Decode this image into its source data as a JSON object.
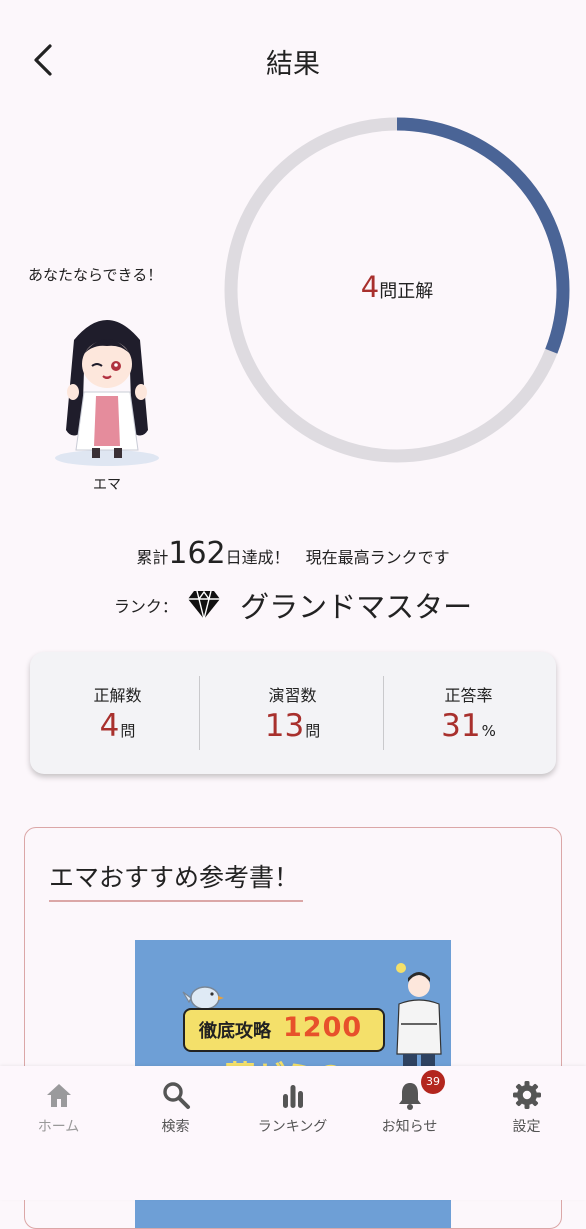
{
  "header": {
    "title": "結果",
    "back_icon": "chevron-left-icon"
  },
  "character": {
    "speech": "あなたならできる！",
    "name": "エマ"
  },
  "progress": {
    "correct_count": "4",
    "correct_unit": "問正解",
    "fraction": 0.31,
    "fill_color": "#4a6496",
    "track_color": "#dedbe0"
  },
  "streak": {
    "prefix": "累計",
    "days": "162",
    "suffix": "日達成！　現在最高ランクです"
  },
  "rank": {
    "prefix": "ランク：",
    "name": "グランドマスター",
    "icon": "diamond-icon"
  },
  "stats": [
    {
      "label": "正解数",
      "value": "4",
      "unit": "問"
    },
    {
      "label": "演習数",
      "value": "13",
      "unit": "問"
    },
    {
      "label": "正答率",
      "value": "31",
      "unit": "%"
    }
  ],
  "recommend": {
    "title": "エマおすすめ参考書！",
    "book_prefix": "徹底攻略",
    "book_number": "1200",
    "book_subtitle": "薬ゼミの"
  },
  "nav": [
    {
      "label": "ホーム",
      "icon": "home-icon"
    },
    {
      "label": "検索",
      "icon": "search-icon"
    },
    {
      "label": "ランキング",
      "icon": "ranking-icon"
    },
    {
      "label": "お知らせ",
      "icon": "bell-icon",
      "badge": "39"
    },
    {
      "label": "設定",
      "icon": "gear-icon"
    }
  ],
  "colors": {
    "accent_red": "#a8302d",
    "ring_blue": "#4a6496",
    "background": "#fcf7fb"
  }
}
